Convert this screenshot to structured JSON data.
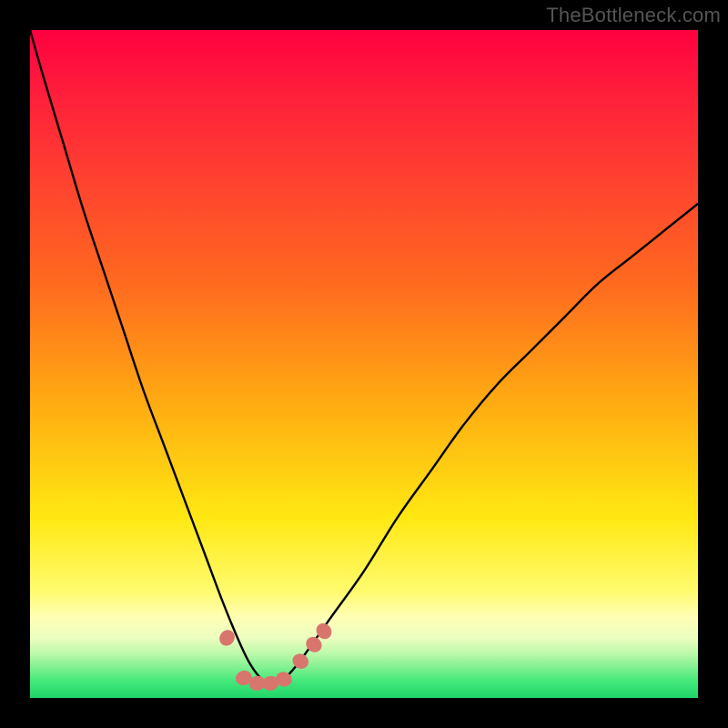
{
  "watermark": "TheBottleneck.com",
  "chart_data": {
    "type": "line",
    "title": "",
    "xlabel": "",
    "ylabel": "",
    "xlim": [
      0,
      100
    ],
    "ylim": [
      0,
      100
    ],
    "grid": false,
    "legend": false,
    "gradient_colors": {
      "top": "#ff0040",
      "mid_upper": "#ff6a1f",
      "mid": "#ffe812",
      "mid_lower": "#fffeb6",
      "bottom": "#1fd46a"
    },
    "series": [
      {
        "name": "bottleneck-curve",
        "color": "#000000",
        "x": [
          0,
          2,
          5,
          8,
          11,
          14,
          17,
          20,
          23,
          26,
          29,
          31.5,
          33,
          34.5,
          36,
          37.5,
          40,
          45,
          50,
          55,
          60,
          65,
          70,
          75,
          80,
          85,
          90,
          95,
          100
        ],
        "y": [
          100,
          93,
          83,
          73,
          64,
          55,
          46,
          38,
          30,
          22,
          14,
          8,
          5,
          3,
          2,
          2.5,
          5,
          12,
          19,
          27,
          34,
          41,
          47,
          52,
          57,
          62,
          66,
          70,
          74
        ]
      }
    ],
    "markers": {
      "name": "bottom-points",
      "color": "#d8766e",
      "shape": "sausage",
      "points": [
        {
          "x": 29.5,
          "y": 9.0
        },
        {
          "x": 32.0,
          "y": 3.0
        },
        {
          "x": 34.0,
          "y": 2.2
        },
        {
          "x": 36.0,
          "y": 2.2
        },
        {
          "x": 38.0,
          "y": 2.8
        },
        {
          "x": 40.5,
          "y": 5.5
        },
        {
          "x": 42.5,
          "y": 8.0
        },
        {
          "x": 44.0,
          "y": 10.0
        }
      ]
    }
  }
}
